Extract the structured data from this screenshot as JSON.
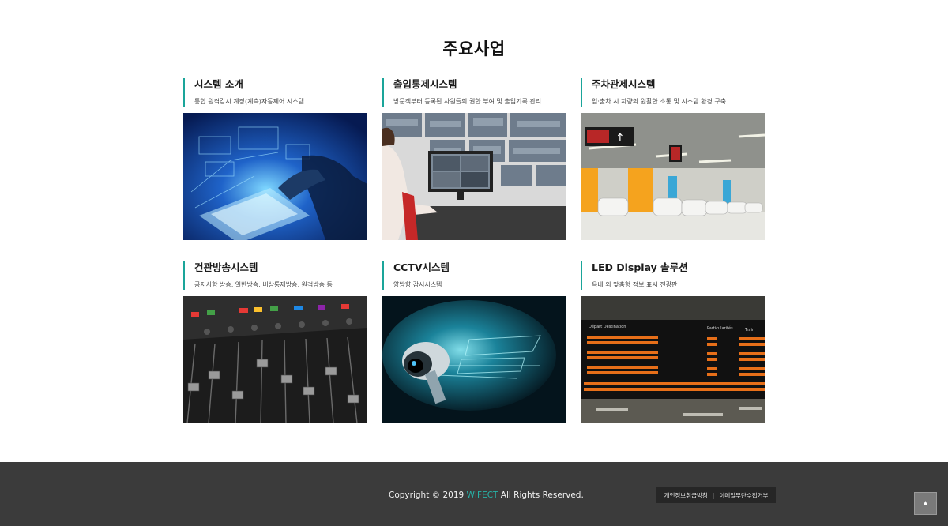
{
  "section": {
    "title": "주요사업"
  },
  "cards": [
    {
      "title": "시스템 소개",
      "desc": "통합 원격감시 계장(계측)자동제어 시스템",
      "image": "tablet-hologram-image"
    },
    {
      "title": "출입통제시스템",
      "desc": "방문객부터 등록된 사원들의 권한 부여 및 출입기록 관리",
      "image": "control-room-image"
    },
    {
      "title": "주차관제시스템",
      "desc": "입·출차 시 차량의 원활한 소통 및 시스템 환경 구축",
      "image": "parking-garage-image"
    },
    {
      "title": "건관방송시스템",
      "desc": "공지사항 방송, 일반방송, 비상통제방송, 원격방송 등",
      "image": "audio-mixer-image"
    },
    {
      "title": "CCTV시스템",
      "desc": "양방향 감시시스템",
      "image": "cctv-camera-image"
    },
    {
      "title": "LED Display 솔루션",
      "desc": "옥내 외 맞춤형 정보 표시 전광판",
      "image": "departure-board-image"
    }
  ],
  "footer": {
    "copyright_prefix": "Copyright © 2019 ",
    "brand": "WIFECT",
    "copyright_suffix": " All Rights Reserved.",
    "privacy_link": "개인정보취급방침",
    "email_link": "이메일무단수집거부",
    "top_icon": "arrow-up-icon"
  },
  "colors": {
    "accent": "#1aa59a",
    "footer_bg": "#3b3b3b"
  }
}
